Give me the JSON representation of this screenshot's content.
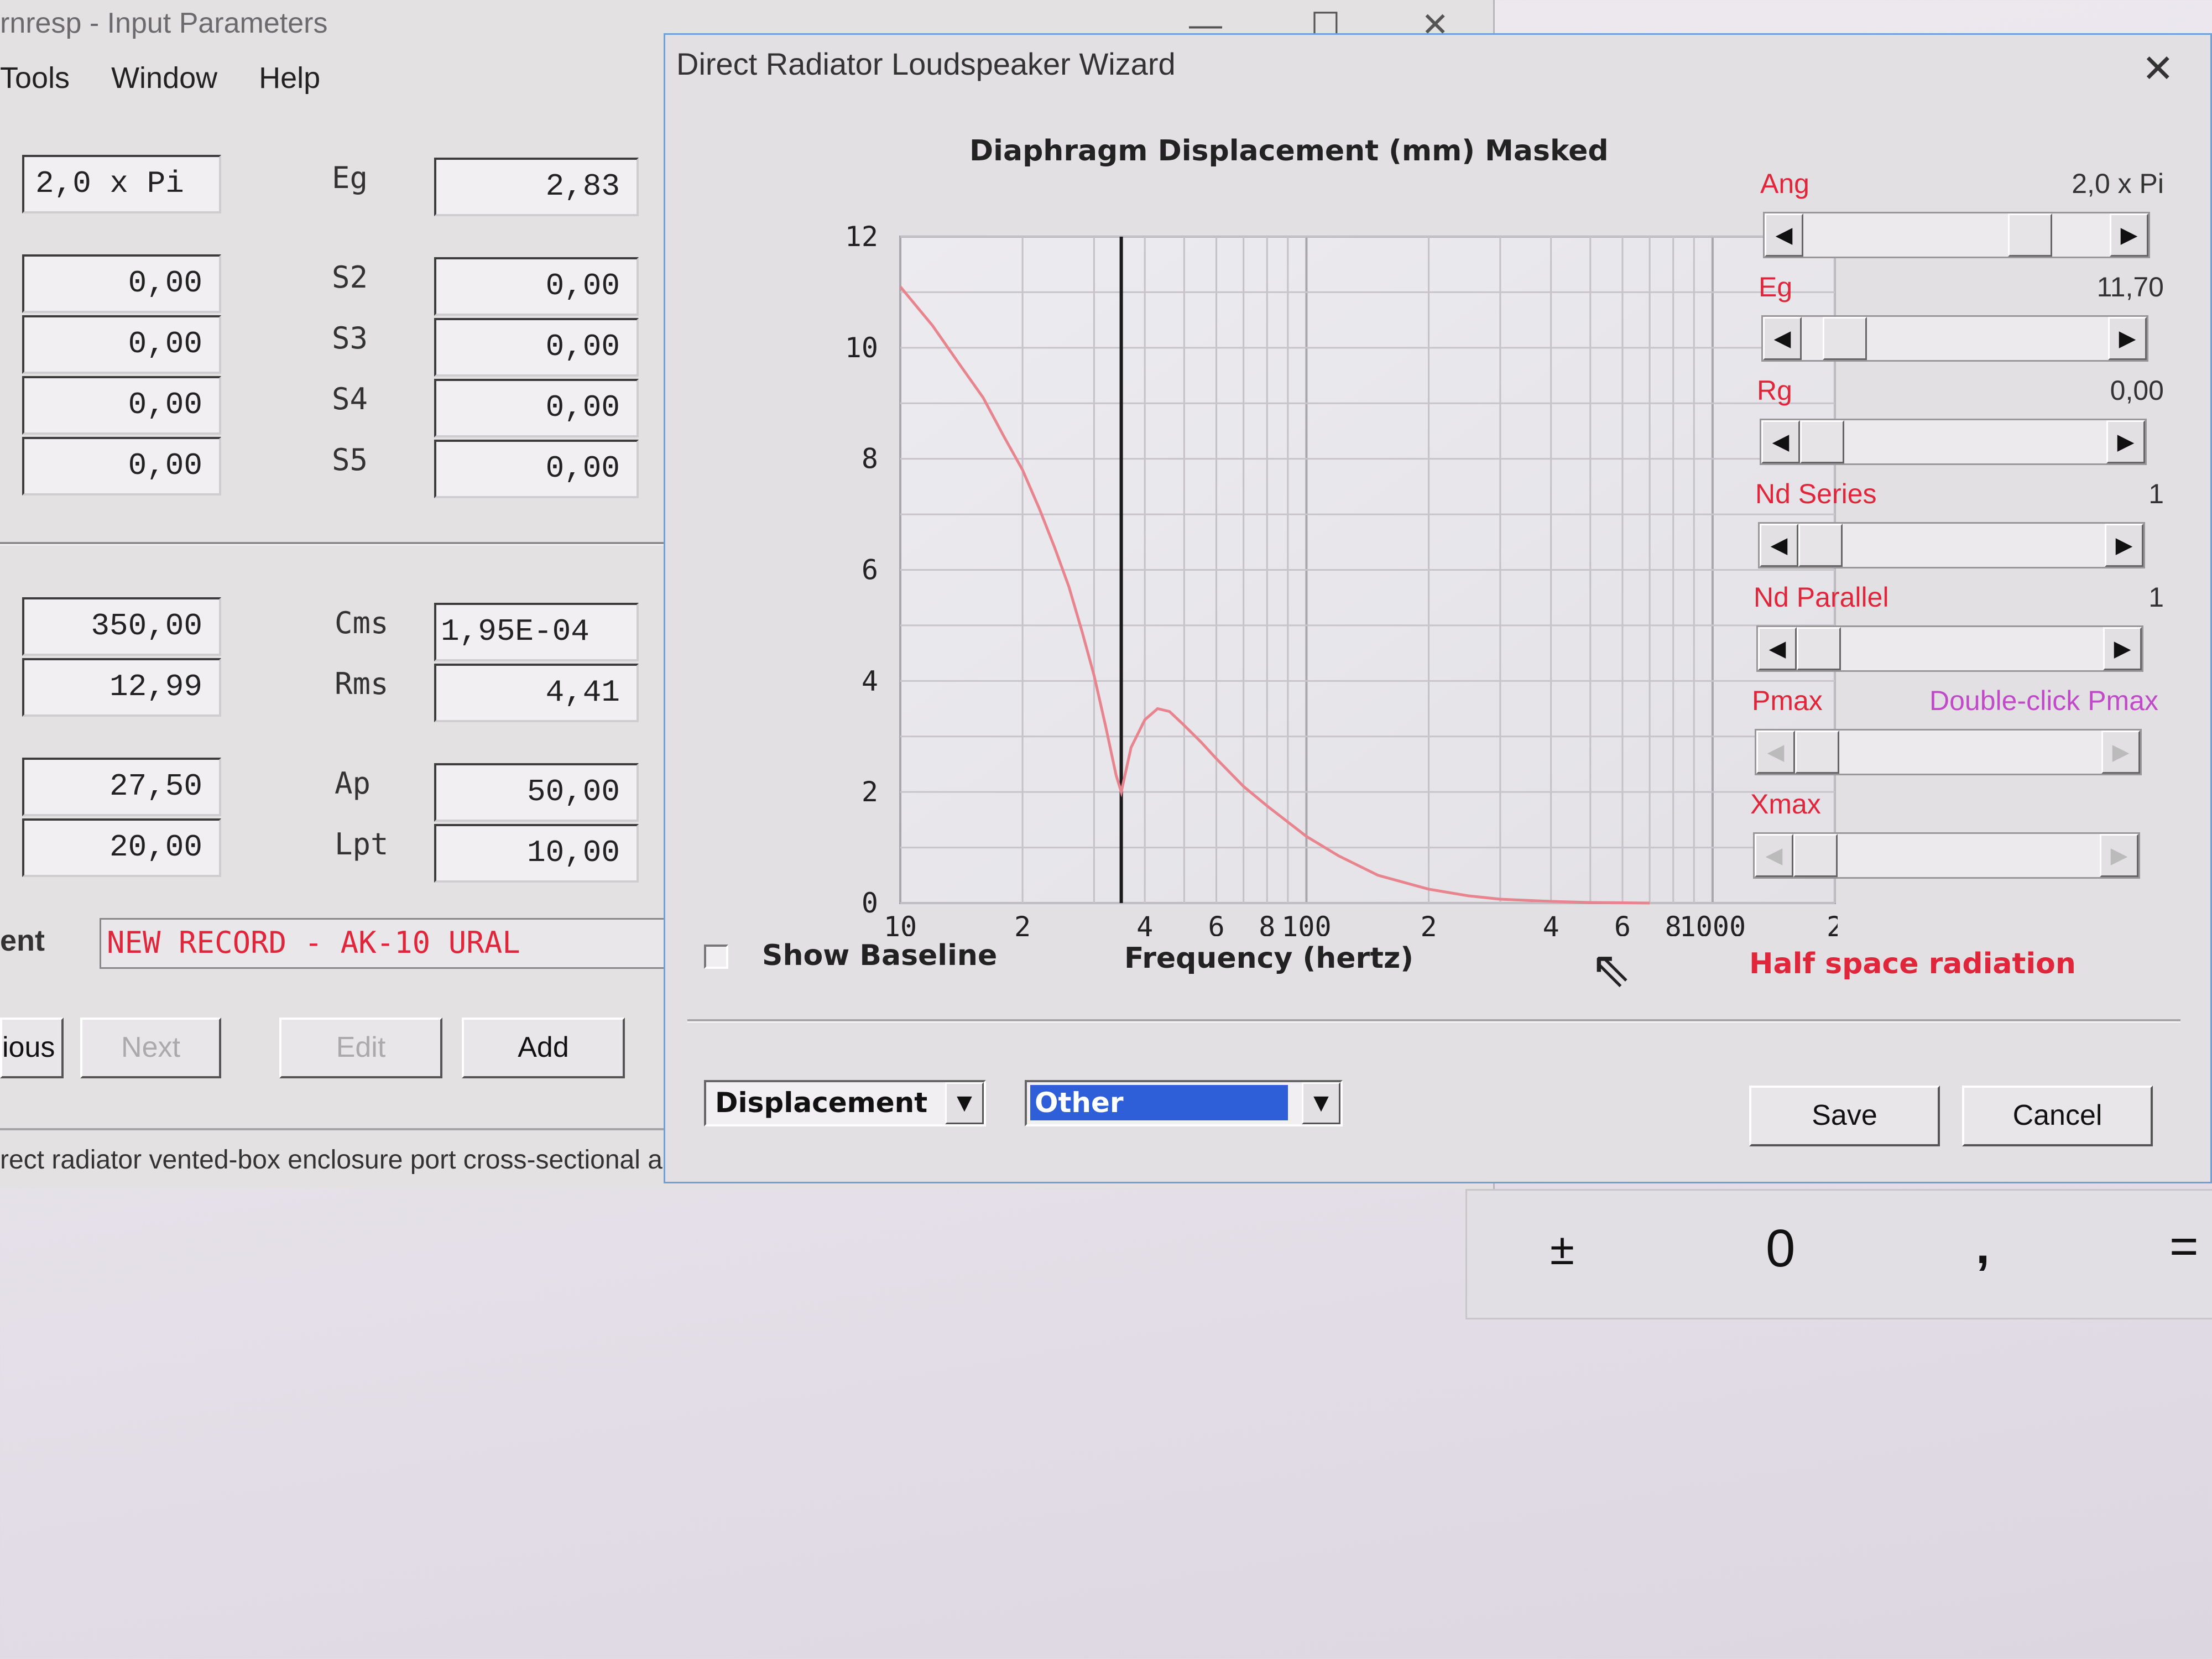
{
  "background_window": {
    "title": "rnresp - Input Parameters",
    "menu": [
      "Tools",
      "Window",
      "Help"
    ],
    "left_fields": [
      "2,0 x Pi",
      "0,00",
      "0,00",
      "0,00",
      "0,00"
    ],
    "mid_labels": [
      "Eg",
      "S2",
      "S3",
      "S4",
      "S5"
    ],
    "right_fields": [
      "2,83",
      "0,00",
      "0,00",
      "0,00",
      "0,00"
    ],
    "lower_left_fields": [
      "350,00",
      "12,99",
      "27,50",
      "20,00"
    ],
    "lower_labels": [
      "Cms",
      "Rms",
      "Ap",
      "Lpt"
    ],
    "lower_right_fields": [
      "1,95E-04",
      "4,41",
      "50,00",
      "10,00"
    ],
    "record_label": "ent",
    "record_value": "NEW RECORD - AK-10 URAL",
    "buttons": [
      "ious",
      "Next",
      "Edit",
      "Add"
    ],
    "status": "rect radiator vented-box enclosure port cross-sectional a"
  },
  "calculator": {
    "plusminus": "±",
    "zero": "0",
    "comma": ",",
    "equals": "="
  },
  "dialog": {
    "title": "Direct Radiator Loudspeaker Wizard",
    "close": "✕",
    "chart_heading": "Diaphragm Displacement (mm)   Masked",
    "show_baseline": "Show Baseline",
    "half_space": "Half space radiation",
    "combo_type": "Displacement",
    "combo_other": "Other",
    "save": "Save",
    "cancel": "Cancel",
    "params": [
      {
        "label": "Ang",
        "value": "2,0 x Pi",
        "thumb": 0.78,
        "disabled": false
      },
      {
        "label": "Eg",
        "value": "11,70",
        "thumb": 0.08,
        "disabled": false
      },
      {
        "label": "Rg",
        "value": "0,00",
        "thumb": 0.0,
        "disabled": false
      },
      {
        "label": "Nd  Series",
        "value": "1",
        "thumb": 0.0,
        "disabled": false
      },
      {
        "label": "Nd  Parallel",
        "value": "1",
        "thumb": 0.0,
        "disabled": false
      },
      {
        "label": "Pmax",
        "value": "Double-click Pmax",
        "thumb": 0.0,
        "disabled": true
      },
      {
        "label": "Xmax",
        "value": "",
        "thumb": 0.0,
        "disabled": true
      }
    ]
  },
  "colors": {
    "curve": "#e8848e",
    "marker": "#1a1a1a",
    "param_label": "#e0263a",
    "pmax_hint": "#c04bc8"
  },
  "chart_data": {
    "type": "line",
    "title": "Diaphragm Displacement (mm)   Masked",
    "xlabel": "Frequency (hertz)",
    "ylabel": "",
    "x_scale": "log",
    "xlim": [
      10,
      2000
    ],
    "ylim": [
      0,
      12
    ],
    "y_ticks": [
      "0",
      "2",
      "4",
      "6",
      "8",
      "10",
      "12"
    ],
    "x_ticks": [
      {
        "v": 10,
        "t": "10"
      },
      {
        "v": 20,
        "t": "2"
      },
      {
        "v": 40,
        "t": "4"
      },
      {
        "v": 60,
        "t": "6"
      },
      {
        "v": 80,
        "t": "8"
      },
      {
        "v": 100,
        "t": "100"
      },
      {
        "v": 200,
        "t": "2"
      },
      {
        "v": 400,
        "t": "4"
      },
      {
        "v": 600,
        "t": "6"
      },
      {
        "v": 800,
        "t": "8"
      },
      {
        "v": 1000,
        "t": "1000"
      },
      {
        "v": 2000,
        "t": "2"
      }
    ],
    "grid": true,
    "marker_x": 35,
    "series": [
      {
        "x": [
          10,
          12,
          14,
          16,
          18,
          20,
          22,
          24,
          26,
          28,
          30,
          32,
          34,
          35,
          37,
          40,
          43,
          46,
          50,
          55,
          60,
          70,
          80,
          100,
          120,
          150,
          200,
          250,
          300,
          400,
          500,
          700
        ],
        "y": [
          11.1,
          10.4,
          9.7,
          9.1,
          8.4,
          7.8,
          7.1,
          6.4,
          5.7,
          4.9,
          4.1,
          3.2,
          2.3,
          2.0,
          2.8,
          3.3,
          3.5,
          3.45,
          3.2,
          2.9,
          2.6,
          2.1,
          1.75,
          1.2,
          0.85,
          0.5,
          0.25,
          0.13,
          0.07,
          0.03,
          0.01,
          0.0
        ]
      }
    ]
  }
}
